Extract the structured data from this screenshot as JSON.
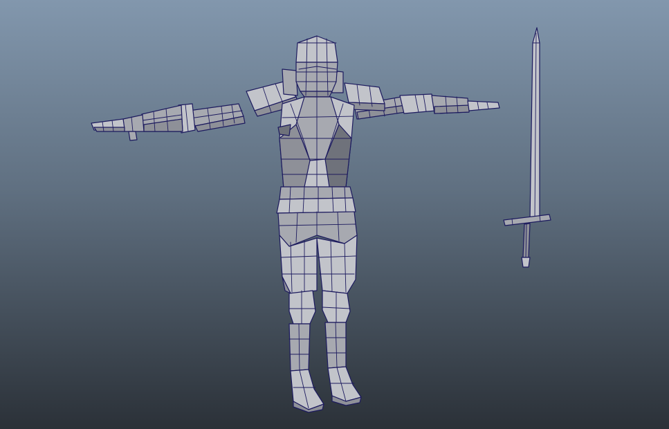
{
  "viewport": {
    "background_top": "#8297ad",
    "background_bottom": "#2b3138",
    "mesh_fill": "#a7a9b0",
    "mesh_shade": "#8e9098",
    "mesh_light": "#c2c4ca",
    "mesh_dark": "#6f727b",
    "wireframe_color": "#1c1a5e"
  },
  "scene": {
    "objects": [
      {
        "name": "knight-armor-model",
        "icon": "knight-mesh-icon"
      },
      {
        "name": "longsword-model",
        "icon": "sword-mesh-icon"
      }
    ]
  }
}
